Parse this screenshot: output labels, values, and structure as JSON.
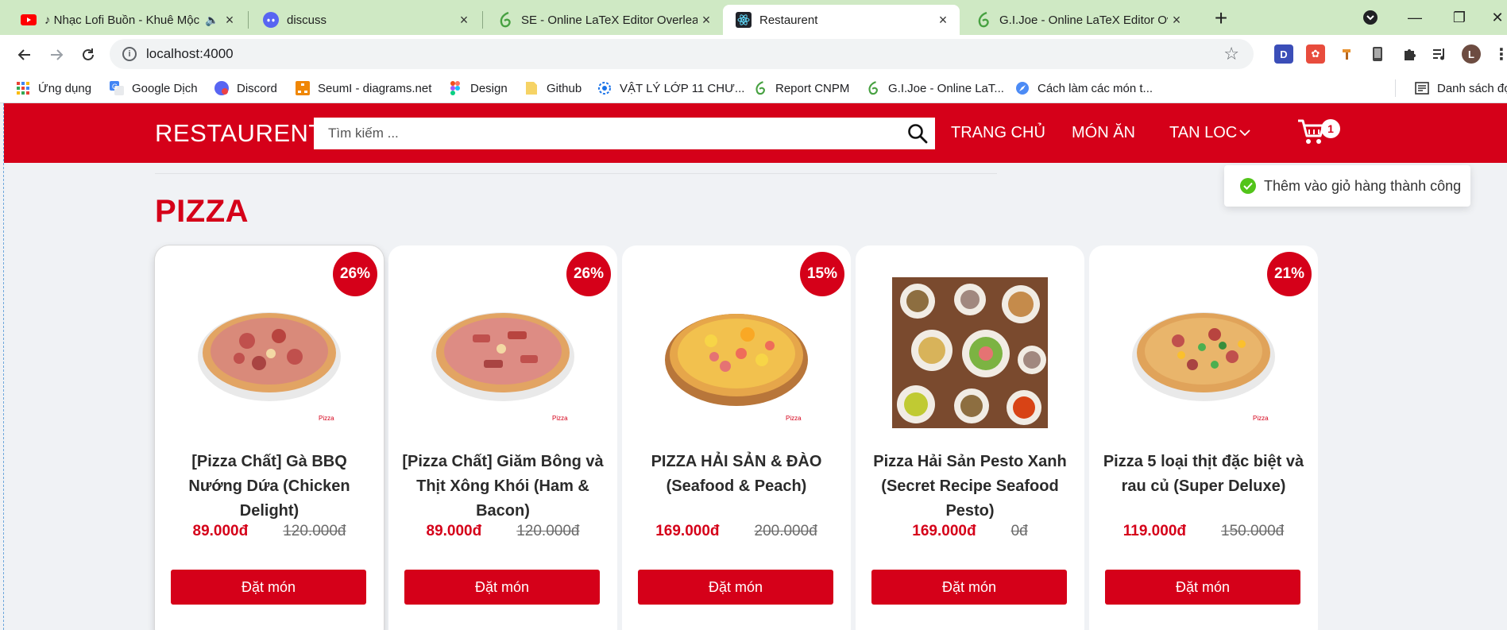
{
  "browser": {
    "tabs": [
      {
        "title": "♪ Nhạc Lofi Buồn - Khuê Mộc",
        "icon": "youtube-icon"
      },
      {
        "title": "discuss",
        "icon": "discord-icon"
      },
      {
        "title": "SE - Online LaTeX Editor Overleaf",
        "icon": "overleaf-icon"
      },
      {
        "title": "Restaurent",
        "icon": "react-icon"
      },
      {
        "title": "G.I.Joe - Online LaTeX Editor Overleaf",
        "icon": "overleaf-icon"
      }
    ],
    "url": "localhost:4000",
    "profile_initial": "L",
    "extensions": [
      "D"
    ],
    "bookmarks": [
      {
        "label": "Ứng dụng",
        "icon": "apps-grid-icon"
      },
      {
        "label": "Google Dịch",
        "icon": "google-translate-icon"
      },
      {
        "label": "Discord",
        "icon": "discord-icon"
      },
      {
        "label": "SeumI - diagrams.net",
        "icon": "drawio-icon"
      },
      {
        "label": "Design",
        "icon": "figma-icon"
      },
      {
        "label": "Github",
        "icon": "folder-icon"
      },
      {
        "label": "VẬT LÝ LỚP 11 CHƯ...",
        "icon": "gear-globe-icon"
      },
      {
        "label": "Report CNPM",
        "icon": "overleaf-icon"
      },
      {
        "label": "G.I.Joe - Online LaT...",
        "icon": "overleaf-icon"
      },
      {
        "label": "Cách làm các món t...",
        "icon": "compass-icon"
      }
    ],
    "reading_list": "Danh sách đọc"
  },
  "site": {
    "logo": "RESTAURENT",
    "search_placeholder": "Tìm kiếm ...",
    "nav": {
      "home": "TRANG CHỦ",
      "dishes": "MÓN ĂN",
      "filter": "TAN LOC"
    },
    "cart_count": "1",
    "brand_color": "#d50019"
  },
  "toast": {
    "message": "Thêm vào giỏ hàng thành công",
    "status_color": "#52c41a"
  },
  "section_title": "PIZZA",
  "products": [
    {
      "name": "[Pizza Chất] Gà BBQ Nướng Dứa (Chicken Delight)",
      "discount": "26%",
      "price": "89.000đ",
      "old_price": "120.000đ",
      "button": "Đặt món",
      "image": "pizza-chicken"
    },
    {
      "name": "[Pizza Chất] Giăm Bông và Thịt Xông Khói (Ham & Bacon)",
      "discount": "26%",
      "price": "89.000đ",
      "old_price": "120.000đ",
      "button": "Đặt món",
      "image": "pizza-ham"
    },
    {
      "name": "PIZZA HẢI SẢN & ĐÀO (Seafood & Peach)",
      "discount": "15%",
      "price": "169.000đ",
      "old_price": "200.000đ",
      "button": "Đặt món",
      "image": "pizza-seafood-peach"
    },
    {
      "name": "Pizza Hải Sản Pesto Xanh (Secret Recipe Seafood Pesto)",
      "discount": "",
      "price": "169.000đ",
      "old_price": "0đ",
      "button": "Đặt món",
      "image": "food-table-photo"
    },
    {
      "name": "Pizza 5 loại thịt đặc biệt và rau củ (Super Deluxe)",
      "discount": "21%",
      "price": "119.000đ",
      "old_price": "150.000đ",
      "button": "Đặt món",
      "image": "pizza-deluxe"
    }
  ]
}
